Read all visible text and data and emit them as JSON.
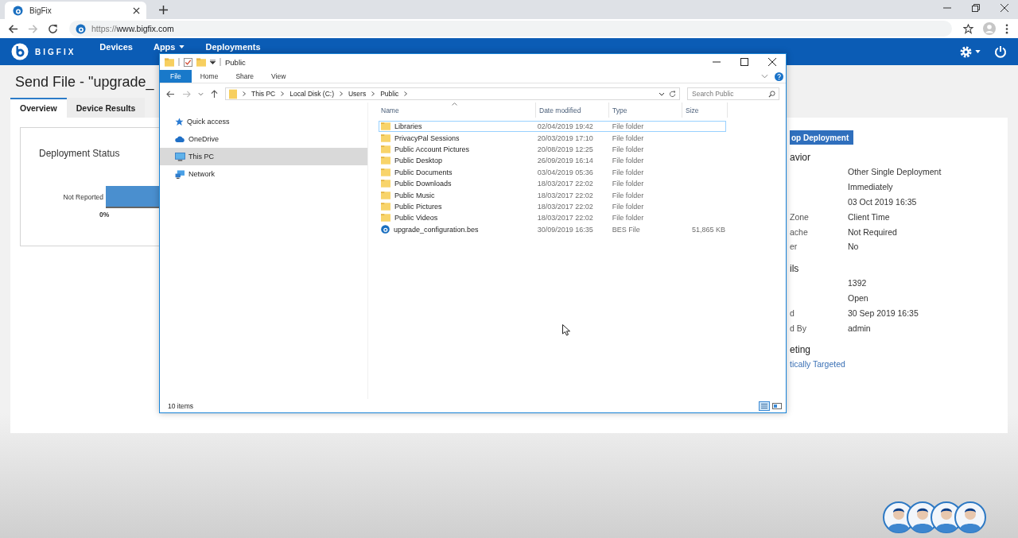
{
  "browser": {
    "tab_title": "BigFix",
    "url_scheme": "https://",
    "url_host": "www.bigfix.com"
  },
  "app_nav": {
    "brand": "BIGFIX",
    "items": [
      {
        "label": "Devices",
        "dropdown": false
      },
      {
        "label": "Apps",
        "dropdown": true
      },
      {
        "label": "Deployments",
        "dropdown": false
      }
    ]
  },
  "page": {
    "title": "Send File - \"upgrade_",
    "tabs": [
      {
        "label": "Overview",
        "selected": true
      },
      {
        "label": "Device Results",
        "selected": false
      }
    ],
    "status_card": {
      "title": "Deployment Status",
      "bar_label": "Not Reported",
      "axis_label": "0%"
    },
    "action_button": "op Deployment",
    "sections": [
      {
        "heading": "avior",
        "rows": [
          {
            "value": "Other Single Deployment"
          },
          {
            "value": "Immediately"
          },
          {
            "value": "03 Oct 2019 16:35"
          },
          {
            "label": "Zone",
            "value": "Client Time"
          },
          {
            "label": "ache",
            "value": "Not Required"
          },
          {
            "label": "er",
            "value": "No"
          }
        ]
      },
      {
        "heading": "ils",
        "rows": [
          {
            "value": "1392"
          },
          {
            "value": "Open"
          },
          {
            "label": "d",
            "value": "30 Sep 2019 16:35"
          },
          {
            "label": "d By",
            "value": "admin"
          }
        ]
      },
      {
        "heading": "eting",
        "link": "tically Targeted"
      }
    ]
  },
  "explorer": {
    "title": "Public",
    "ribbon_tabs": [
      {
        "label": "File",
        "kind": "backstage"
      },
      {
        "label": "Home",
        "kind": "tab"
      },
      {
        "label": "Share",
        "kind": "tab"
      },
      {
        "label": "View",
        "kind": "tab"
      }
    ],
    "breadcrumbs": [
      "This PC",
      "Local Disk (C:)",
      "Users",
      "Public"
    ],
    "search_placeholder": "Search Public",
    "nav": [
      {
        "label": "Quick access",
        "kind": "star",
        "selected": false
      },
      {
        "label": "OneDrive",
        "kind": "cloud",
        "selected": false
      },
      {
        "label": "This PC",
        "kind": "computer",
        "selected": true
      },
      {
        "label": "Network",
        "kind": "network",
        "selected": false
      }
    ],
    "columns": [
      "Name",
      "Date modified",
      "Type",
      "Size"
    ],
    "files": [
      {
        "name": "Libraries",
        "date": "02/04/2019 19:42",
        "type": "File folder",
        "kind": "folder",
        "focused": true
      },
      {
        "name": "PrivacyPal Sessions",
        "date": "20/03/2019 17:10",
        "type": "File folder",
        "kind": "folder",
        "focused": false
      },
      {
        "name": "Public Account Pictures",
        "date": "20/08/2019 12:25",
        "type": "File folder",
        "kind": "folder",
        "focused": false
      },
      {
        "name": "Public Desktop",
        "date": "26/09/2019 16:14",
        "type": "File folder",
        "kind": "folder",
        "focused": false
      },
      {
        "name": "Public Documents",
        "date": "03/04/2019 05:36",
        "type": "File folder",
        "kind": "folder",
        "focused": false
      },
      {
        "name": "Public Downloads",
        "date": "18/03/2017 22:02",
        "type": "File folder",
        "kind": "folder",
        "focused": false
      },
      {
        "name": "Public Music",
        "date": "18/03/2017 22:02",
        "type": "File folder",
        "kind": "folder",
        "focused": false
      },
      {
        "name": "Public Pictures",
        "date": "18/03/2017 22:02",
        "type": "File folder",
        "kind": "folder",
        "focused": false
      },
      {
        "name": "Public Videos",
        "date": "18/03/2017 22:02",
        "type": "File folder",
        "kind": "folder",
        "focused": false
      },
      {
        "name": "upgrade_configuration.bes",
        "date": "30/09/2019 16:35",
        "type": "BES File",
        "size": "51,865 KB",
        "kind": "bes",
        "focused": false
      }
    ],
    "status": "10 items"
  }
}
